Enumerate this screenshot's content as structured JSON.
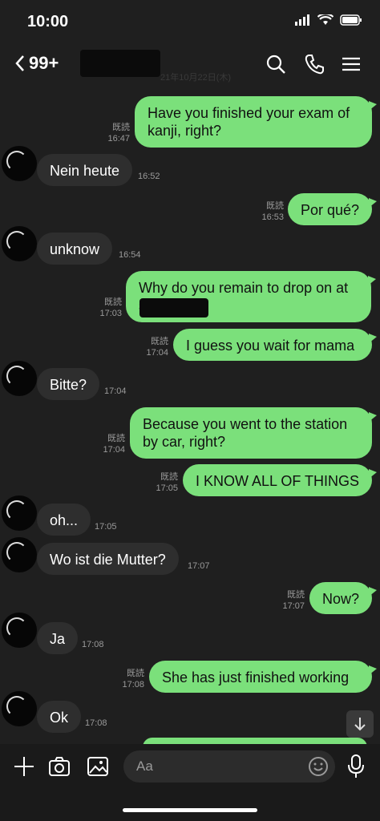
{
  "status": {
    "time": "10:00"
  },
  "header": {
    "back_label": "99+",
    "date_fragment": "21年10月22日(木)"
  },
  "input": {
    "placeholder": "Aa"
  },
  "messages": [
    {
      "dir": "out",
      "text": "Have you finished your exam of\nkanji, right?",
      "read": "既読",
      "time": "16:47"
    },
    {
      "dir": "in",
      "text": "Nein heute",
      "time": "16:52"
    },
    {
      "dir": "out",
      "text": "Por qué?",
      "read": "既読",
      "time": "16:53"
    },
    {
      "dir": "in",
      "text": "unknow",
      "time": "16:54"
    },
    {
      "dir": "out",
      "text": "Why do you remain to drop on at\nstation??",
      "read": "既読",
      "time": "17:03"
    },
    {
      "dir": "out",
      "text": "I guess you wait for mama",
      "read": "既読",
      "time": "17:04"
    },
    {
      "dir": "in",
      "text": "Bitte?",
      "time": "17:04"
    },
    {
      "dir": "out",
      "text": "Because you went to the station\nby car, right?",
      "read": "既読",
      "time": "17:04"
    },
    {
      "dir": "out",
      "text": "I KNOW ALL OF THINGS",
      "read": "既読",
      "time": "17:05"
    },
    {
      "dir": "in",
      "text": "oh...",
      "time": "17:05"
    },
    {
      "dir": "in",
      "text": "Wo ist die Mutter?",
      "time": "17:07"
    },
    {
      "dir": "out",
      "text": "Now?",
      "read": "既読",
      "time": "17:07"
    },
    {
      "dir": "in",
      "text": "Ja",
      "time": "17:08"
    },
    {
      "dir": "out",
      "text": "She has just finished working",
      "read": "既読",
      "time": "17:08"
    },
    {
      "dir": "in",
      "text": "Ok",
      "time": "17:08"
    }
  ]
}
